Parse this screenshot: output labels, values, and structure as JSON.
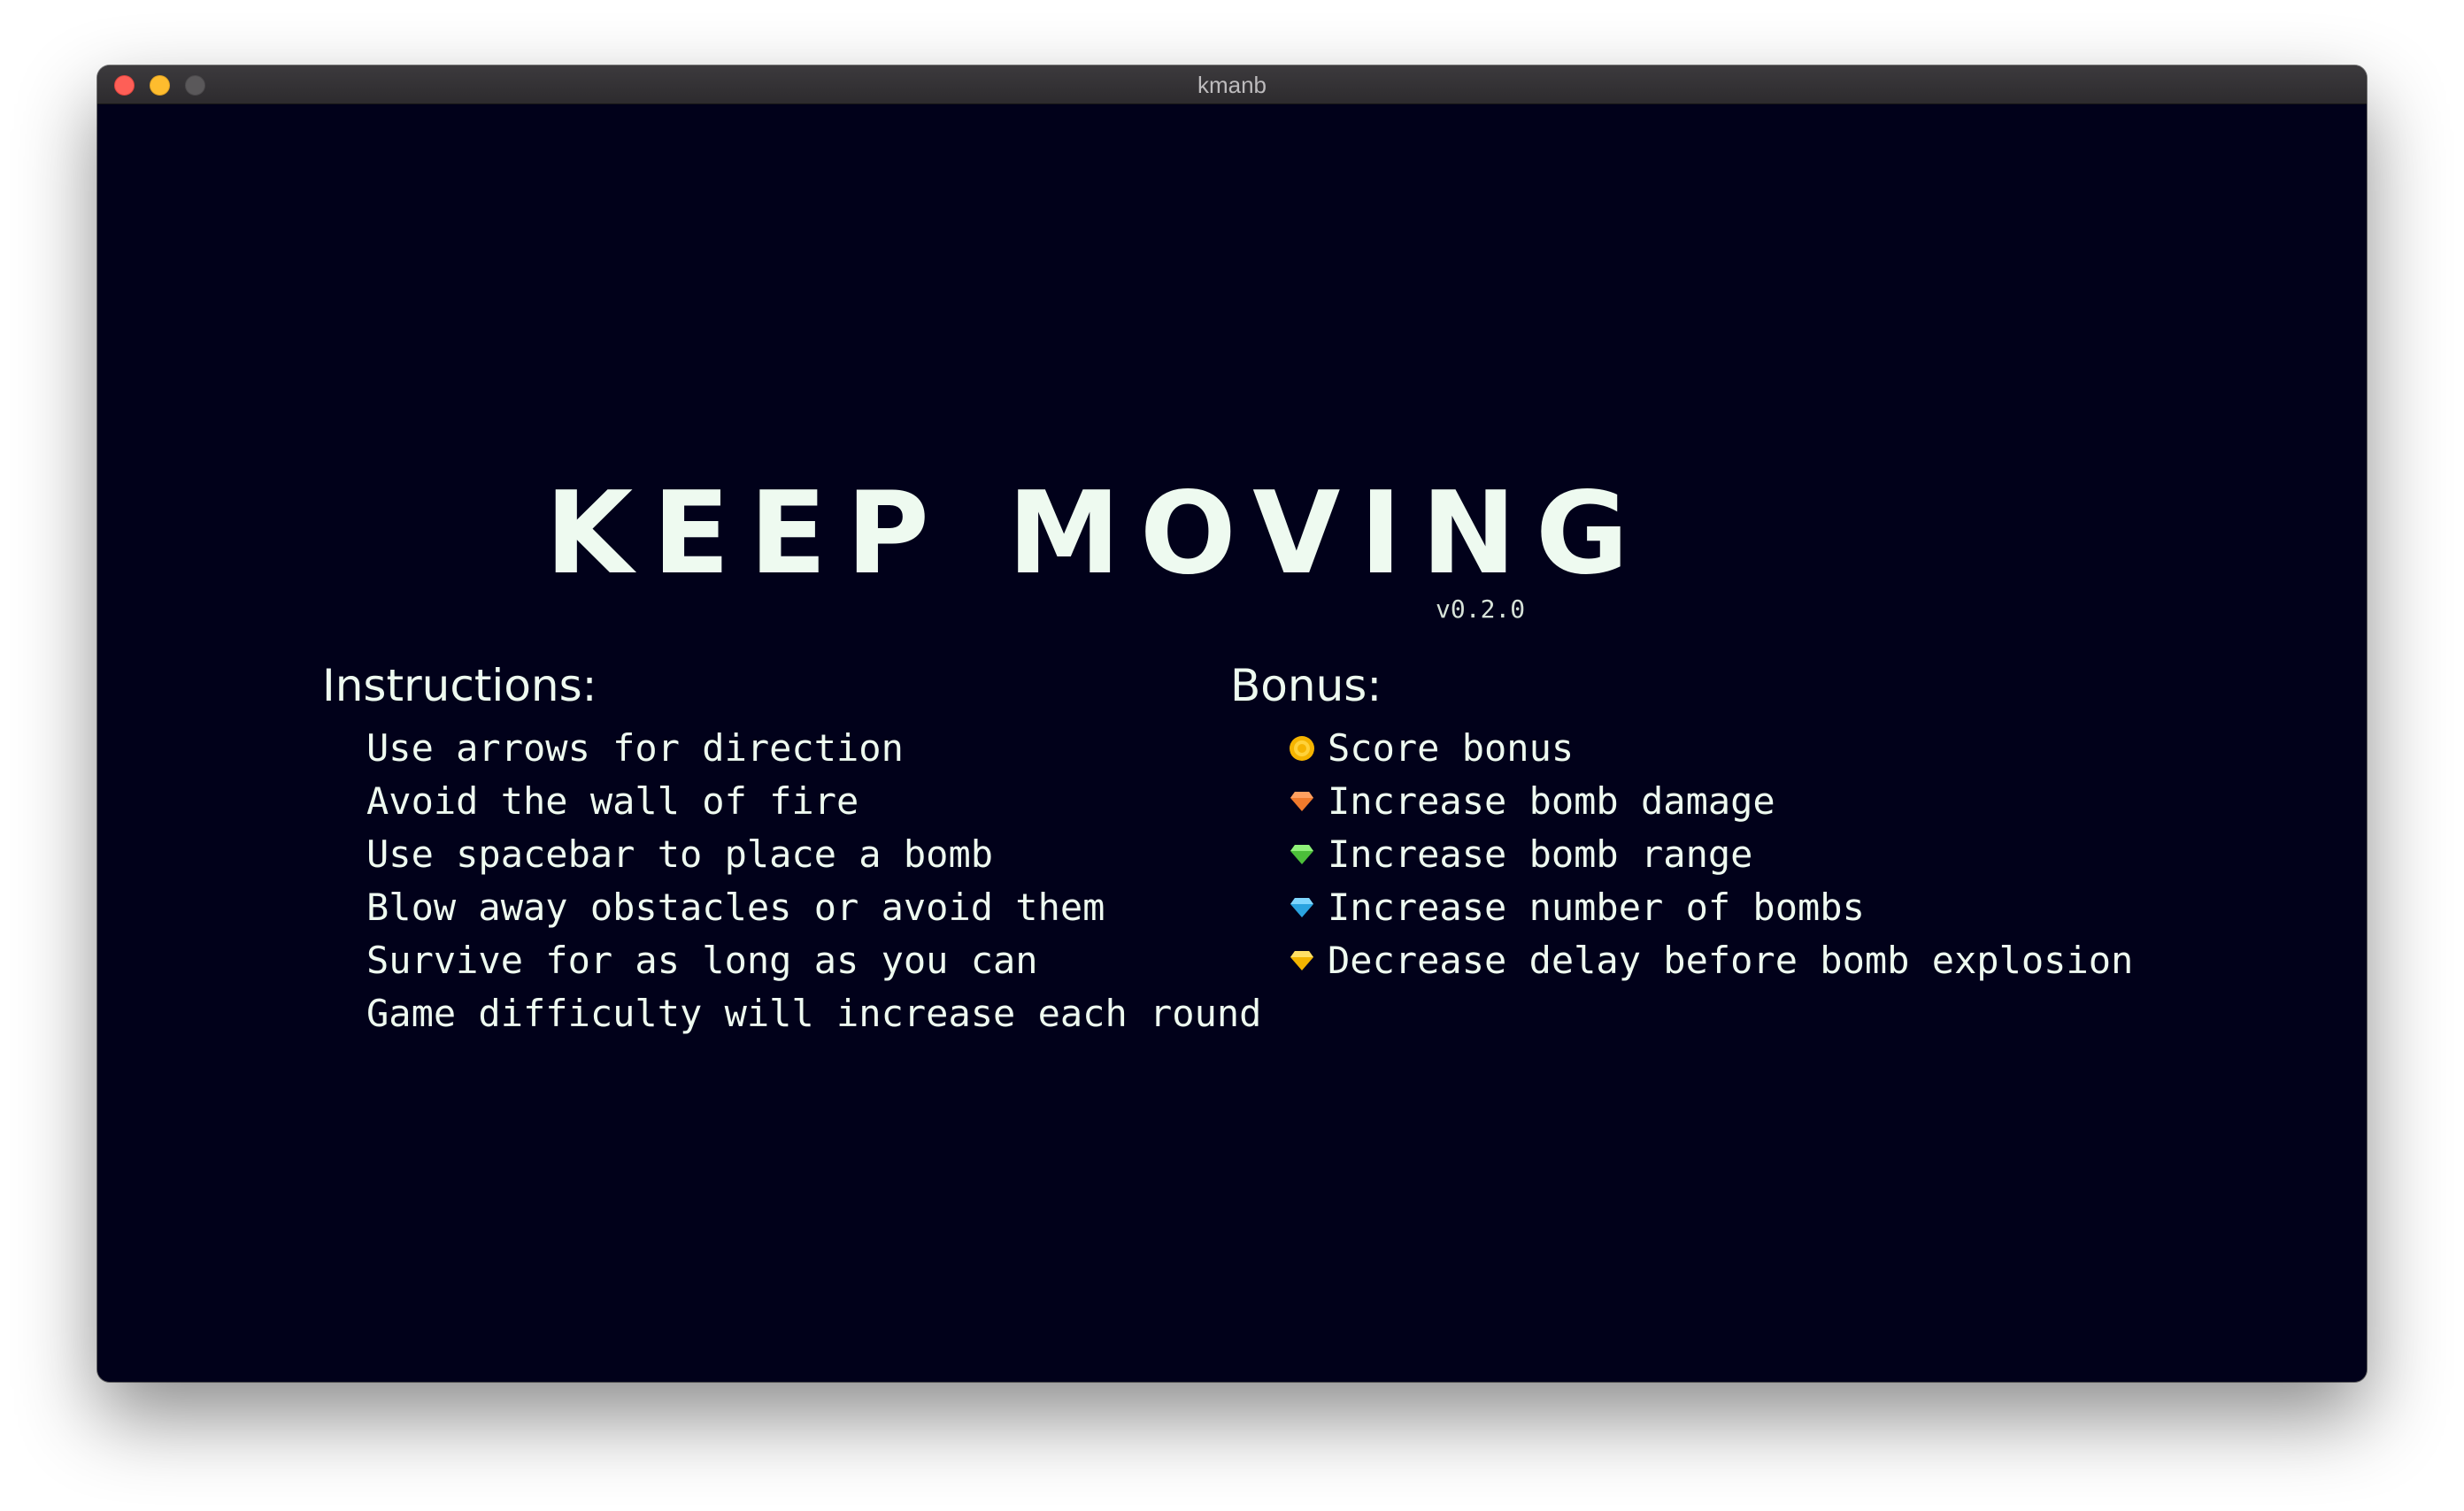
{
  "window": {
    "title": "kmanb"
  },
  "game": {
    "title": "KEEP MOVING",
    "version": "v0.2.0",
    "instructions": {
      "heading": "Instructions:",
      "items": [
        "Use arrows for direction",
        "Avoid the wall of fire",
        "Use spacebar to place a bomb",
        "Blow away obstacles or avoid them",
        "Survive for as long as you can",
        "Game difficulty will increase each round"
      ]
    },
    "bonus": {
      "heading": "Bonus:",
      "items": [
        {
          "icon": "gold-coin-icon",
          "color": "#f5b400",
          "label": "Score bonus"
        },
        {
          "icon": "orange-gem-icon",
          "color": "#f07a2c",
          "label": "Increase bomb damage"
        },
        {
          "icon": "green-gem-icon",
          "color": "#5fd34a",
          "label": "Increase bomb range"
        },
        {
          "icon": "blue-gem-icon",
          "color": "#3bb8f0",
          "label": "Increase number of bombs"
        },
        {
          "icon": "yellow-gem-icon",
          "color": "#ffc21a",
          "label": "Decrease delay before bomb explosion"
        }
      ]
    }
  }
}
